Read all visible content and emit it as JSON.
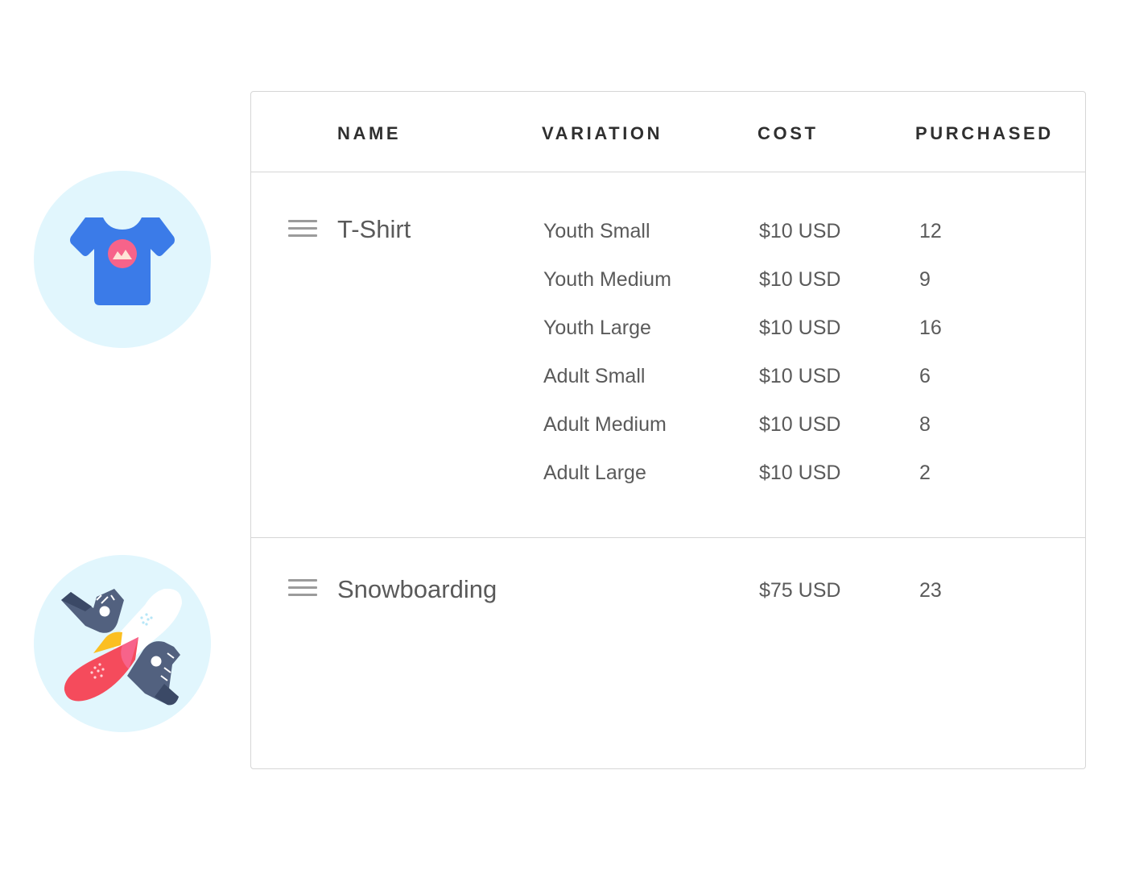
{
  "columns": {
    "name": "NAME",
    "variation": "VARIATION",
    "cost": "COST",
    "purchased": "PURCHASED"
  },
  "products": [
    {
      "name": "T-Shirt",
      "icon": "tshirt-icon",
      "variations": [
        {
          "label": "Youth Small",
          "cost": "$10 USD",
          "purchased": "12"
        },
        {
          "label": "Youth Medium",
          "cost": "$10 USD",
          "purchased": "9"
        },
        {
          "label": "Youth Large",
          "cost": "$10 USD",
          "purchased": "16"
        },
        {
          "label": "Adult Small",
          "cost": "$10 USD",
          "purchased": "6"
        },
        {
          "label": "Adult Medium",
          "cost": "$10 USD",
          "purchased": "8"
        },
        {
          "label": "Adult Large",
          "cost": "$10 USD",
          "purchased": "2"
        }
      ]
    },
    {
      "name": "Snowboarding",
      "icon": "snowboard-icon",
      "cost": "$75 USD",
      "purchased": "23"
    }
  ],
  "colors": {
    "circle_bg": "#e1f6fd",
    "tshirt_blue": "#3b7be8",
    "accent_pink": "#f7638a",
    "snowboard_red": "#f54b5c",
    "boot_slate": "#52617f",
    "border": "#d6d6d6"
  }
}
